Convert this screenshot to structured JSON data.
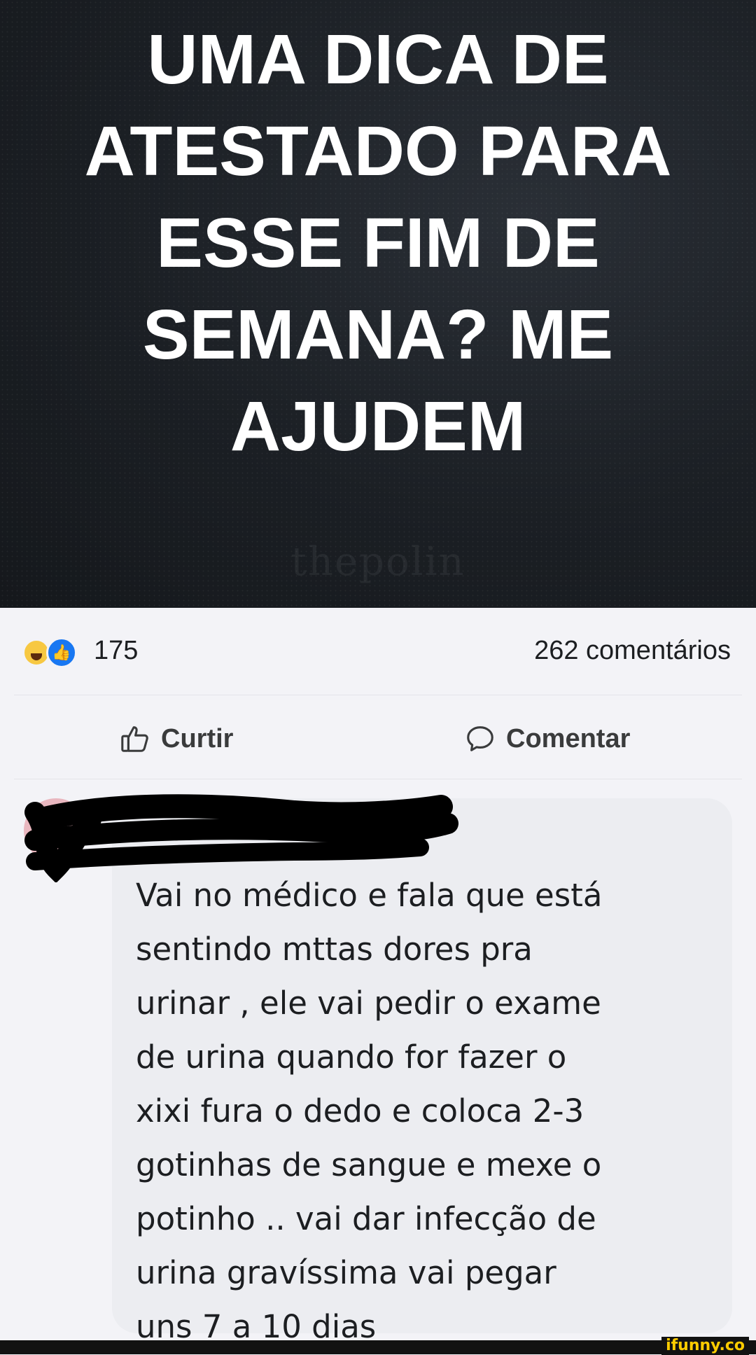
{
  "post": {
    "headline_lines": [
      "UMA DICA DE",
      "ATESTADO PARA",
      "ESSE FIM DE",
      "SEMANA? ME",
      "AJUDEM"
    ],
    "watermark": "thepolin"
  },
  "stats": {
    "reaction_count": "175",
    "comments_count": "262 comentários",
    "reaction_icons": [
      "haha-icon",
      "like-icon"
    ]
  },
  "actions": {
    "like_label": "Curtir",
    "comment_label": "Comentar"
  },
  "comment": {
    "author": "",
    "text_lines": [
      "Vai no médico e fala que está",
      "sentindo mttas dores pra",
      "urinar , ele vai pedir o exame",
      "de urina quando for fazer o",
      "xixi fura o dedo e coloca 2-3",
      "gotinhas de sangue e mexe o",
      "potinho .. vai dar infecção de",
      "urina gravíssima vai pegar",
      "uns 7 a 10 dias"
    ]
  },
  "footer": {
    "brand": "ifunny.co"
  },
  "colors": {
    "brand_blue": "#1877f2",
    "haha_yellow": "#f7c842",
    "bubble": "#ecedf1",
    "ifunny_yellow": "#ffcc00"
  }
}
